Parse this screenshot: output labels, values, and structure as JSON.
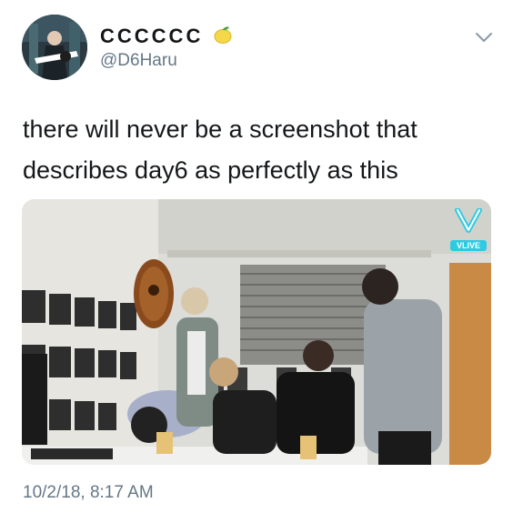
{
  "tweet": {
    "display_name": "CCCCCC",
    "name_emoji": "lemon",
    "handle": "@D6Haru",
    "text_line1": "there will never be a screenshot that",
    "text_line2": "describes day6 as perfectly as this",
    "timestamp": "10/2/18, 8:17 AM"
  },
  "media": {
    "watermark": "VLIVE",
    "description": "five people in a studio room with a guitar on the wall"
  },
  "icons": {
    "menu": "chevron-down-icon"
  }
}
